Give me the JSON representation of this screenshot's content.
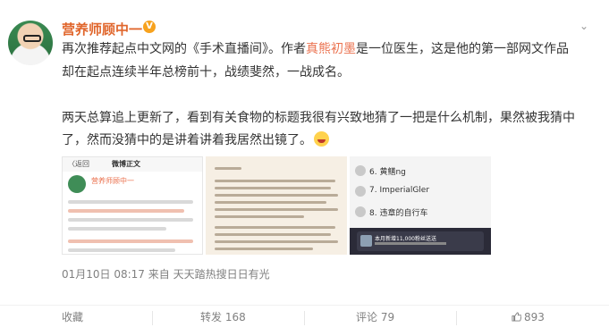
{
  "post": {
    "author": "营养师顾中一",
    "verified_badge": "V",
    "menu_icon": "chevron-down-icon",
    "line1_a": "再次推荐起点中文网的《手术直播间》。作者",
    "line1_link": "真熊初墨",
    "line1_b": "是一位医生，这是他的第一部网文作品",
    "line2": "却在起点连续半年总榜前十，战绩斐然，一战成名。",
    "line3": "两天总算追上更新了，看到有关食物的标题我很有兴致地猜了一把是什么机制，果然被我猜中",
    "line4": "了，然而没猜中的是讲着讲着我居然出镜了。",
    "emoji": "laugh-cry-emoji",
    "meta": "01月10日 08:17  来自 天天踏热搜日日有光"
  },
  "thumbs": {
    "t1_back": "〈返回",
    "t1_title": "微博正文",
    "t1_name": "营养师顾中一",
    "t3_rows": [
      "6. 黄鳝ng",
      "7. ImperialGler",
      "8. 违章的自行车"
    ],
    "t3_banner": "本月新增11,000粉丝送送"
  },
  "actions": {
    "favorite": "收藏",
    "repost": "转发 168",
    "comment": "评论 79",
    "like": "893"
  }
}
